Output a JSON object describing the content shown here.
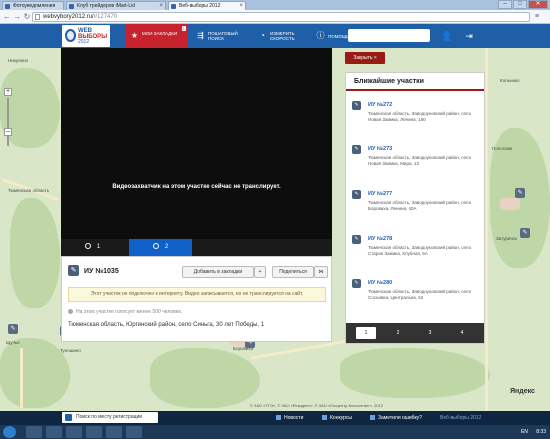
{
  "browser": {
    "tabs": [
      {
        "label": "Фотоуведомления"
      },
      {
        "label": "Клуб трейдеров iMart-Lid"
      },
      {
        "label": "Веб-выборы 2012"
      }
    ],
    "url_host": "webvybory2012.ru/",
    "url_hash": "#127470",
    "window_buttons": {
      "min": "–",
      "max": "□",
      "close": "✕"
    }
  },
  "site": {
    "logo": {
      "line1": "WEB",
      "line2": "ВЫБОРЫ",
      "line3": "2012"
    },
    "nav": [
      {
        "label": "МОИ ЗАКЛАДКИ",
        "icon": "star-icon",
        "badge": "1"
      },
      {
        "label": "ПОШАГОВЫЙ ПОИСК",
        "icon": "steps-icon"
      },
      {
        "label": "ИЗМЕРИТЬ СКОРОСТЬ",
        "icon": "speed-icon"
      },
      {
        "label": "ПОМОЩЬ",
        "icon": "help-icon"
      }
    ]
  },
  "map": {
    "labels": {
      "nikulino": "Никулино",
      "komarovo": "Тюменская область",
      "tyumen_oblast": "Тюменская область",
      "borovikha": "Боровиха",
      "tunshino": "Туношино",
      "shchuchye": "Щучье",
      "kolnikovo": "Кольнико",
      "pravdinsk": "Полосаки",
      "zaturinsk": "Затуринск"
    },
    "footer": "© ЗАО «ТГЭ», © ЗАО «Резидент», © ЗАО «Геоцентр-Консалтинг», 2012",
    "yandex": "Яндекс"
  },
  "video": {
    "message": "Видеозахватчик на этом участке сейчас не транслирует.",
    "camera_tabs": [
      {
        "label": "1"
      },
      {
        "label": "2"
      }
    ],
    "active_camera": 2
  },
  "station": {
    "title": "ИУ №1035",
    "add_bookmark": "Добавить в закладки",
    "plus": "+",
    "share": "Поделиться",
    "notice": "Этот участок не подключен к интернету. Видео записывается, но не транслируется на сайт.",
    "voters": "На этом участке голосует менее 500 человек.",
    "address": "Тюменская область, Юргинский район, село Синьга, 30 лет Победы, 1"
  },
  "nearby": {
    "close_label": "Закрыть ×",
    "title": "Ближайшие участки",
    "items": [
      {
        "name": "ИУ №272",
        "address": "Тюменская область, Заводоуковский район, село Новая Заимка, Ленина, 180"
      },
      {
        "name": "ИУ №273",
        "address": "Тюменская область, Заводоуковский район, село Новая Заимка, Мира, 13"
      },
      {
        "name": "ИУ №277",
        "address": "Тюменская область, Заводоуковский район, село Боровиха, Ленина, 40А"
      },
      {
        "name": "ИУ №278",
        "address": "Тюменская область, Заводоуковский район, село Старая Заимка, Клубная, 5А"
      },
      {
        "name": "ИУ №280",
        "address": "Тюменская область, Заводоуковский район, село Сосновка, Центральна, 52"
      }
    ],
    "pages": [
      "1",
      "2",
      "3",
      "4"
    ],
    "active_page": "1"
  },
  "bottombar": {
    "search": "Поиск по месту регистрации",
    "links": [
      {
        "label": "Новости"
      },
      {
        "label": "Конкурсы"
      },
      {
        "label": "Заметили ошибку?"
      }
    ],
    "copyright": "Веб-выборы 2012"
  },
  "taskbar": {
    "lang": "EN",
    "time": "8:33"
  }
}
